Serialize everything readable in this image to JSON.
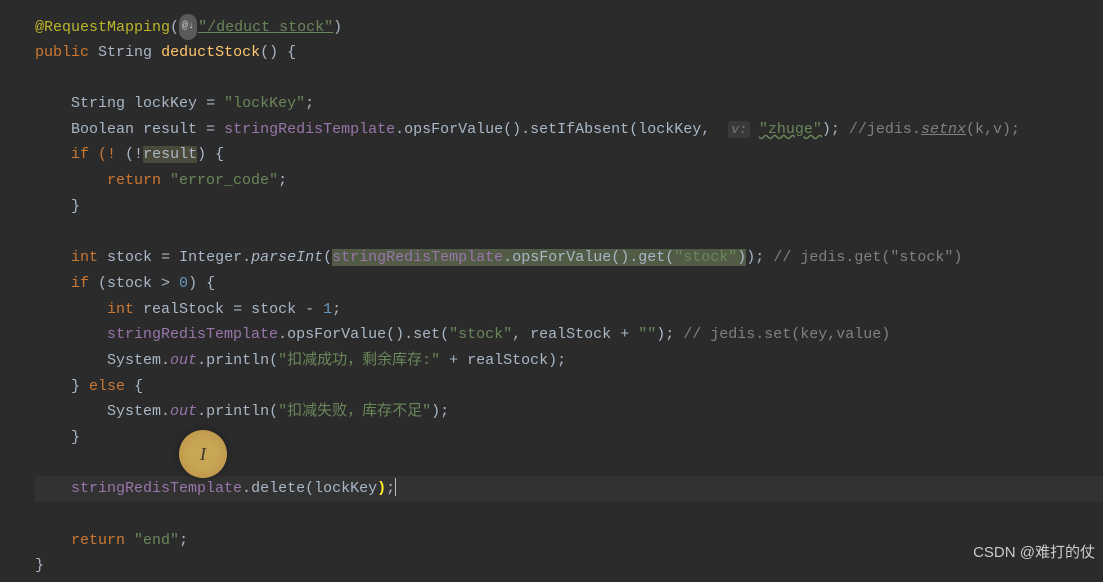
{
  "annotation": {
    "name": "@RequestMapping",
    "icon_hint": "@↓",
    "path": "\"/deduct_stock\""
  },
  "method_signature": {
    "modifier": "public",
    "return_type": "String",
    "name": "deductStock",
    "params": "()"
  },
  "body": {
    "lockKey_decl": {
      "type": "String",
      "name": "lockKey",
      "value": "\"lockKey\""
    },
    "result_decl": {
      "type": "Boolean",
      "name": "result",
      "template": "stringRedisTemplate",
      "method": "opsForValue",
      "chain": "setIfAbsent",
      "arg1": "lockKey",
      "param_hint": "v:",
      "arg2": "\"zhuge\"",
      "comment": "//jedis.",
      "comment_method": "setnx",
      "comment_tail": "(k,v);"
    },
    "if_result": {
      "cond_pre": "if (!",
      "cond_var": "result",
      "cond_post": ") {"
    },
    "return_error": {
      "kw": "return",
      "val": "\"error_code\""
    },
    "close_brace": "}",
    "stock_decl": {
      "type": "int",
      "name": "stock",
      "integer": "Integer",
      "parseInt": "parseInt",
      "template": "stringRedisTemplate",
      "ops": "opsForValue",
      "get": "get",
      "arg": "\"stock\"",
      "comment": "// jedis.get(\"stock\")"
    },
    "if_stock": {
      "kw": "if",
      "cond": " (stock > ",
      "zero": "0",
      "tail": ") {"
    },
    "realStock_decl": {
      "type": "int",
      "name": "realStock",
      "expr": " = stock - ",
      "one": "1"
    },
    "set_stock": {
      "template": "stringRedisTemplate",
      "ops": "opsForValue",
      "set": "set",
      "arg1": "\"stock\"",
      "arg2": "realStock",
      "plus": " + ",
      "empty": "\"\"",
      "comment": "// jedis.set(key,value)"
    },
    "println_success": {
      "system": "System",
      "out": "out",
      "println": "println",
      "msg": "\"扣减成功，剩余库存:\"",
      "plus": " + realStock"
    },
    "else": {
      "close": "}",
      "kw": "else",
      "open": "{"
    },
    "println_fail": {
      "system": "System",
      "out": "out",
      "println": "println",
      "msg": "\"扣减失败，库存不足\""
    },
    "delete_line": {
      "template": "stringRedisTemplate",
      "delete": "delete",
      "arg": "lockKey"
    },
    "return_end": {
      "kw": "return",
      "val": "\"end\""
    }
  },
  "cursor_glyph": "I",
  "watermark": "CSDN @难打的仗"
}
